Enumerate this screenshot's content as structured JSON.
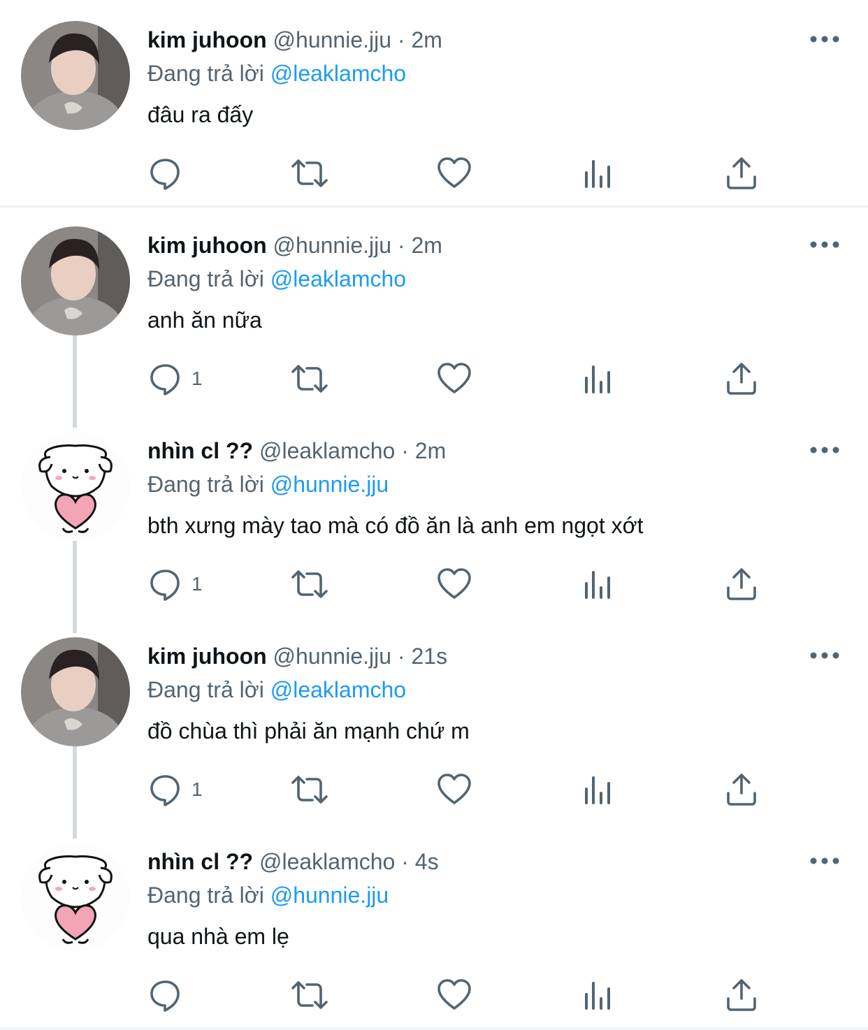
{
  "reply_prefix": "Đang trả lời",
  "tweets": [
    {
      "name": "kim juhoon",
      "handle": "@hunnie.jju",
      "time": "2m",
      "reply_to": "@leaklamcho",
      "text": "đâu ra đấy",
      "reply_count": "",
      "avatar": "photo-avatar",
      "thread_below": false
    },
    {
      "name": "kim juhoon",
      "handle": "@hunnie.jju",
      "time": "2m",
      "reply_to": "@leaklamcho",
      "text": "anh ăn nữa",
      "reply_count": "1",
      "avatar": "photo-avatar",
      "thread_below": true
    },
    {
      "name": "nhìn cl ??",
      "handle": "@leaklamcho",
      "time": "2m",
      "reply_to": "@hunnie.jju",
      "text": "bth xưng mày tao mà có đồ ăn là anh em ngọt xớt",
      "reply_count": "1",
      "avatar": "puppy-heart-avatar",
      "thread_below": true
    },
    {
      "name": "kim juhoon",
      "handle": "@hunnie.jju",
      "time": "21s",
      "reply_to": "@leaklamcho",
      "text": "đồ chùa thì phải ăn mạnh chứ m",
      "reply_count": "1",
      "avatar": "photo-avatar",
      "thread_below": true
    },
    {
      "name": "nhìn cl ??",
      "handle": "@leaklamcho",
      "time": "4s",
      "reply_to": "@hunnie.jju",
      "text": "qua nhà em lẹ",
      "reply_count": "",
      "avatar": "puppy-heart-avatar",
      "thread_below": false
    }
  ],
  "colors": {
    "link": "#1d9bf0",
    "secondary_text": "#536471",
    "icon": "#536471",
    "thread_line": "#d2d8dd"
  }
}
